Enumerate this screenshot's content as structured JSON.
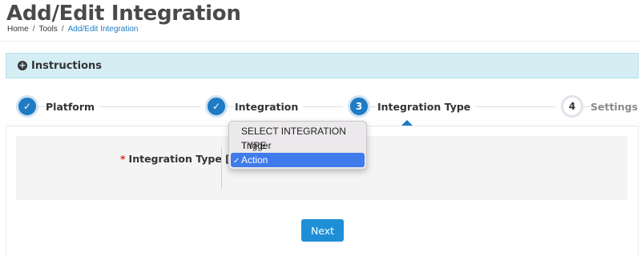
{
  "page": {
    "title": "Add/Edit Integration",
    "breadcrumb": [
      "Home",
      "Tools",
      "Add/Edit Integration"
    ]
  },
  "instructions": {
    "label": "Instructions",
    "icon": "plus-circle-icon"
  },
  "wizard": {
    "steps": [
      {
        "label": "Platform",
        "state": "complete",
        "marker": "✓"
      },
      {
        "label": "Integration",
        "state": "complete",
        "marker": "✓"
      },
      {
        "label": "Integration Type",
        "state": "active",
        "marker": "3"
      },
      {
        "label": "Settings",
        "state": "pending",
        "marker": "4"
      }
    ]
  },
  "form": {
    "field_label": "Integration Type [?]",
    "required_marker": "*",
    "dropdown": {
      "options": [
        "SELECT INTEGRATION TYPE",
        "Trigger",
        "Action"
      ],
      "selected": "Action",
      "check_mark": "✓"
    }
  },
  "actions": {
    "next_label": "Next"
  },
  "colors": {
    "accent": "#1e7bc4",
    "button": "#1e8fd6",
    "instructions_bg": "#d4eef4",
    "required": "#d9302c",
    "dropdown_highlight": "#3f7bea"
  }
}
